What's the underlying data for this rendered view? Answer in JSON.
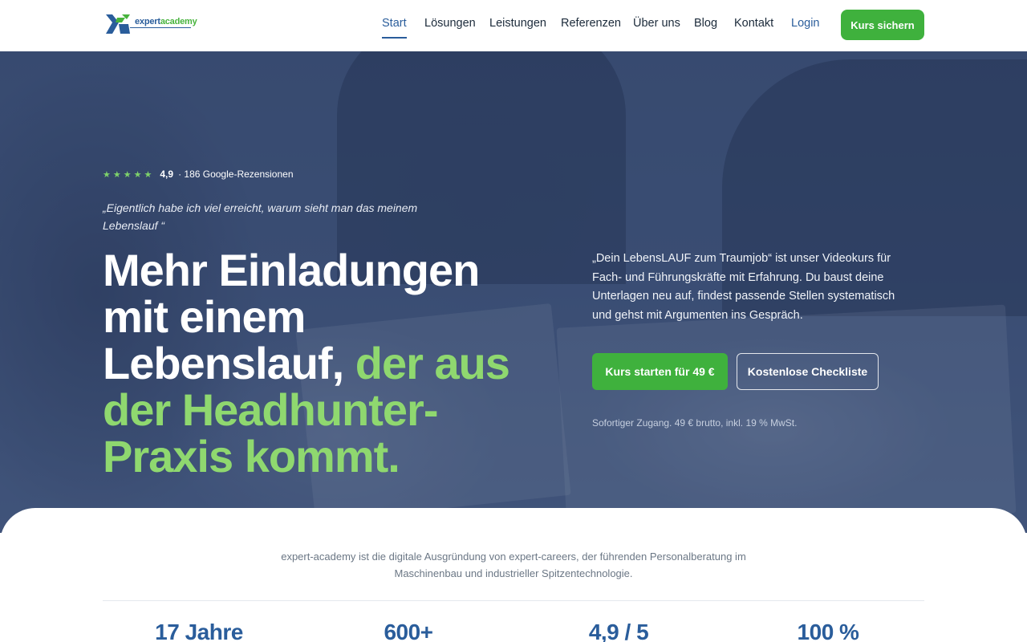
{
  "header": {
    "logo_prefix": "expert",
    "logo_suffix": "academy",
    "nav": [
      {
        "label": "Start",
        "active": true
      },
      {
        "label": "Lösungen"
      },
      {
        "label": "Leistungen"
      },
      {
        "label": "Referenzen"
      },
      {
        "label": "Über uns"
      },
      {
        "label": "Blog"
      },
      {
        "label": "Kontakt"
      },
      {
        "label": "Login"
      }
    ],
    "cta": "Kurs sichern"
  },
  "hero": {
    "rating": {
      "stars": 5,
      "score": "4,9",
      "count_text": "· 186 Google-Rezensionen"
    },
    "quote": "„Eigentlich habe ich viel erreicht, warum sieht man das meinem Lebenslauf “",
    "headline_white": "Mehr Einladungen mit einem Lebenslauf,",
    "headline_green": "der aus der Headhunter-Praxis kommt.",
    "intro": "„Dein LebensLAUF zum Traumjob“ ist unser Videokurs für Fach- und Führungskräfte mit Erfahrung. Du baust deine Unterlagen neu auf, findest passende Stellen systematisch und gehst mit Argumenten ins Gespräch.",
    "primary_button": "Kurs starten für 49 €",
    "secondary_button": "Kostenlose Checkliste",
    "note": "Sofortiger Zugang. 49 € brutto, inkl. 19 % MwSt."
  },
  "section": {
    "about": "expert-academy ist die digitale Ausgründung von expert-careers, der führenden Personalberatung im Maschinenbau und industrieller Spitzentechnologie.",
    "stats": [
      "17 Jahre",
      "600+",
      "4,9 / 5",
      "100 %"
    ]
  },
  "colors": {
    "brand_blue": "#2a5d9b",
    "brand_green": "#3fb13d",
    "headline_green": "#8fd86f",
    "hero_overlay": "#263a64"
  }
}
